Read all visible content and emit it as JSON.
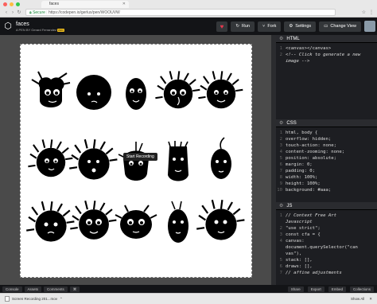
{
  "browser": {
    "tab_title": "faces",
    "secure_label": "Secure",
    "url": "https://codepen.io/gerlux/pen/WOOUVW"
  },
  "pen": {
    "title": "faces",
    "author": "A PEN BY Gerard Ferrandez",
    "pro_badge": "PRO"
  },
  "header": {
    "run_label": "Run",
    "fork_label": "Fork",
    "settings_label": "Settings",
    "change_view_label": "Change View"
  },
  "tooltip": "Start Recording",
  "html_editor": {
    "title": "HTML",
    "lines": [
      {
        "n": "1",
        "t": "<canvas></canvas>"
      },
      {
        "n": "2",
        "t": "<!-- Click to generate a new"
      },
      {
        "n": "",
        "t": "image -->"
      }
    ]
  },
  "css_editor": {
    "title": "CSS",
    "lines": [
      {
        "n": "1",
        "t": "html, body {"
      },
      {
        "n": "2",
        "t": "  overflow: hidden;"
      },
      {
        "n": "3",
        "t": "  touch-action: none;"
      },
      {
        "n": "4",
        "t": "  content-zooming: none;"
      },
      {
        "n": "5",
        "t": "  position: absolute;"
      },
      {
        "n": "6",
        "t": "  margin: 0;"
      },
      {
        "n": "7",
        "t": "  padding: 0;"
      },
      {
        "n": "8",
        "t": "  width: 100%;"
      },
      {
        "n": "9",
        "t": "  height: 100%;"
      },
      {
        "n": "10",
        "t": "  background: #aaa;"
      }
    ]
  },
  "js_editor": {
    "title": "JS",
    "lines": [
      {
        "n": "1",
        "t": "// Context Free Art"
      },
      {
        "n": "",
        "t": "Javascript"
      },
      {
        "n": "2",
        "t": "\"use strict\";"
      },
      {
        "n": "3",
        "t": "const cfa = {"
      },
      {
        "n": "4",
        "t": "  canvas:"
      },
      {
        "n": "",
        "t": "document.querySelector(\"can"
      },
      {
        "n": "",
        "t": "vas\"),"
      },
      {
        "n": "5",
        "t": "  stack: [],"
      },
      {
        "n": "6",
        "t": "  draws: [],"
      },
      {
        "n": "7",
        "t": "  // affine adjustments"
      }
    ]
  },
  "bottom": {
    "console_label": "Console",
    "assets_label": "Assets",
    "comments_label": "Comments",
    "share_label": "Share",
    "export_label": "Export",
    "embed_label": "Embed",
    "collections_label": "Collections"
  },
  "downloads": {
    "file_label": "Screen Recording 201...mov",
    "show_all_label": "Show All"
  }
}
